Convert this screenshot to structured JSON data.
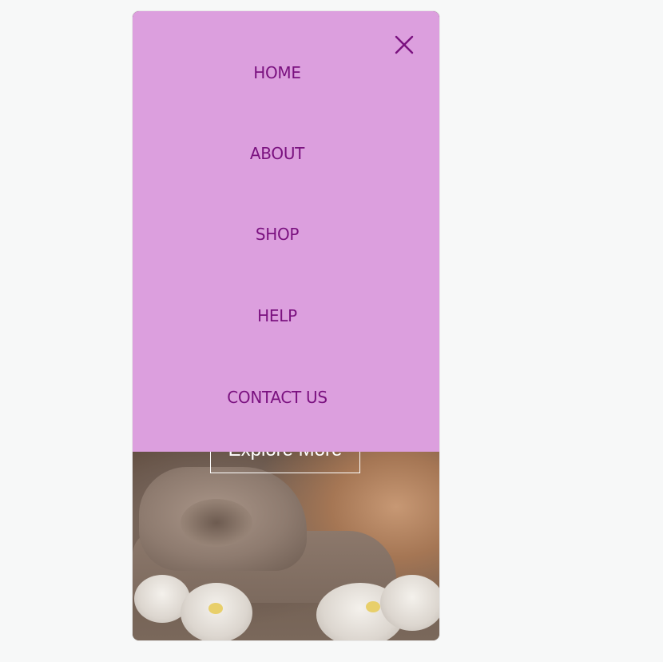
{
  "menu": {
    "items": [
      {
        "label": "HOME"
      },
      {
        "label": "ABOUT"
      },
      {
        "label": "SHOP"
      },
      {
        "label": "HELP"
      },
      {
        "label": "CONTACT US"
      }
    ],
    "close_icon": "close-icon",
    "background_color": "#dc9fde",
    "text_color": "#7a117f"
  },
  "hero": {
    "cta_label": "Explore More"
  }
}
